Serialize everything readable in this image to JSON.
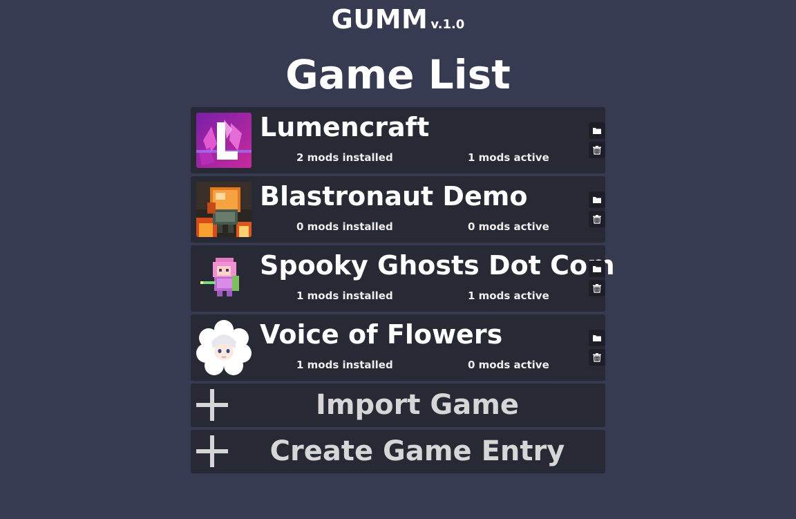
{
  "header": {
    "app_name": "GUMM",
    "version": "v.1.0"
  },
  "page": {
    "title": "Game List"
  },
  "games": [
    {
      "name": "Lumencraft",
      "mods_installed": "2 mods installed",
      "mods_active": "1 mods active",
      "thumb_icon": "lumencraft-logo-icon"
    },
    {
      "name": "Blastronaut Demo",
      "mods_installed": "0 mods installed",
      "mods_active": "0 mods active",
      "thumb_icon": "astronaut-pixel-icon"
    },
    {
      "name": "Spooky Ghosts Dot Com",
      "mods_installed": "1 mods installed",
      "mods_active": "1 mods active",
      "thumb_icon": "ghost-girl-pixel-icon"
    },
    {
      "name": "Voice of Flowers",
      "mods_installed": "1 mods installed",
      "mods_active": "0 mods active",
      "thumb_icon": "flower-character-icon"
    }
  ],
  "actions": {
    "import_label": "Import Game",
    "create_label": "Create Game Entry"
  },
  "colors": {
    "background": "#363b52",
    "card": "#272a35",
    "icon_button": "#1c1f27",
    "text": "#ffffff",
    "muted_text": "#d6d6d6"
  }
}
